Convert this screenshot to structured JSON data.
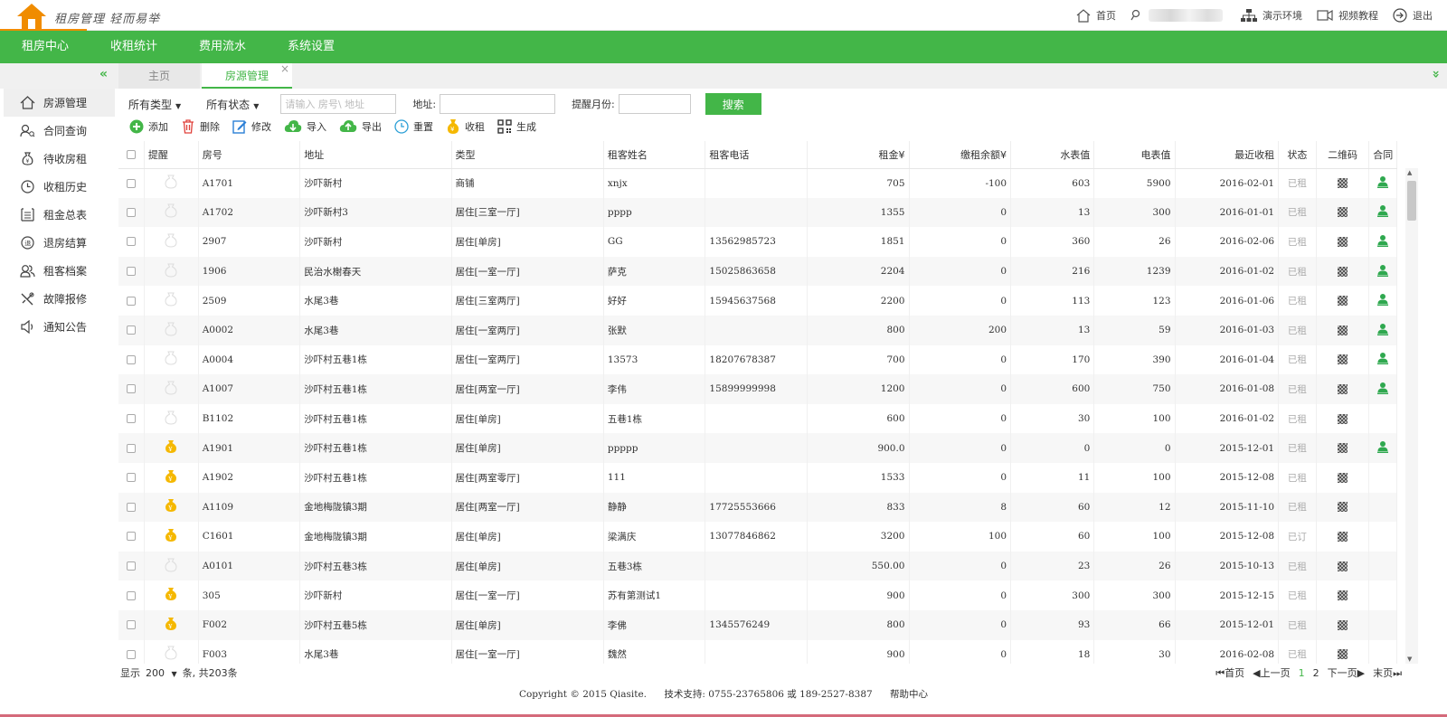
{
  "header": {
    "logo_text": "租房管理 轻而易举",
    "nav": {
      "home": "首页",
      "demo": "演示环境",
      "video": "视频教程",
      "logout": "退出"
    }
  },
  "menu": [
    "租房中心",
    "收租统计",
    "费用流水",
    "系统设置"
  ],
  "tabs": {
    "home": "主页",
    "active": "房源管理",
    "close": "×",
    "collapse": "«",
    "expand": "»"
  },
  "sidebar": [
    {
      "label": "房源管理",
      "icon": "house-icon"
    },
    {
      "label": "合同查询",
      "icon": "contract-search-icon"
    },
    {
      "label": "待收房租",
      "icon": "money-bag-icon"
    },
    {
      "label": "收租历史",
      "icon": "clock-icon"
    },
    {
      "label": "租金总表",
      "icon": "list-icon"
    },
    {
      "label": "退房结算",
      "icon": "checkout-icon"
    },
    {
      "label": "租客档案",
      "icon": "tenants-icon"
    },
    {
      "label": "故障报修",
      "icon": "repair-icon"
    },
    {
      "label": "通知公告",
      "icon": "speaker-icon"
    }
  ],
  "filters": {
    "type_select": "所有类型",
    "status_select": "所有状态",
    "keyword_placeholder": "请输入 房号\\ 地址",
    "address_label": "地址:",
    "month_label": "提醒月份:",
    "search_button": "搜索"
  },
  "toolbar": {
    "add": "添加",
    "delete": "删除",
    "edit": "修改",
    "import": "导入",
    "export": "导出",
    "reset": "重置",
    "collect": "收租",
    "generate": "生成"
  },
  "table": {
    "headers": {
      "remind": "提醒",
      "room": "房号",
      "address": "地址",
      "type": "类型",
      "tenant": "租客姓名",
      "phone": "租客电话",
      "rent": "租金¥",
      "balance": "缴租余额¥",
      "water": "水表值",
      "power": "电表值",
      "last": "最近收租",
      "status": "状态",
      "qr": "二维码",
      "contract": "合同"
    },
    "rows": [
      {
        "remind": false,
        "room": "A1701",
        "address": "沙吓新村",
        "type": "商铺",
        "tenant": "xnjx",
        "phone": "",
        "rent": "705",
        "balance": "-100",
        "water": "603",
        "power": "5900",
        "last": "2016-02-01",
        "status": "已租",
        "contract": true
      },
      {
        "remind": false,
        "room": "A1702",
        "address": "沙吓新村3",
        "type": "居住[三室一厅]",
        "tenant": "pppp",
        "phone": "",
        "rent": "1355",
        "balance": "0",
        "water": "13",
        "power": "300",
        "last": "2016-01-01",
        "status": "已租",
        "contract": true
      },
      {
        "remind": false,
        "room": "2907",
        "address": "沙吓新村",
        "type": "居住[单房]",
        "tenant": "GG",
        "phone": "13562985723",
        "rent": "1851",
        "balance": "0",
        "water": "360",
        "power": "26",
        "last": "2016-02-06",
        "status": "已租",
        "contract": true
      },
      {
        "remind": false,
        "room": "1906",
        "address": "民治水榭春天",
        "type": "居住[一室一厅]",
        "tenant": "萨克",
        "phone": "15025863658",
        "rent": "2204",
        "balance": "0",
        "water": "216",
        "power": "1239",
        "last": "2016-01-02",
        "status": "已租",
        "contract": true
      },
      {
        "remind": false,
        "room": "2509",
        "address": "水尾3巷",
        "type": "居住[三室两厅]",
        "tenant": "好好",
        "phone": "15945637568",
        "rent": "2200",
        "balance": "0",
        "water": "113",
        "power": "123",
        "last": "2016-01-06",
        "status": "已租",
        "contract": true
      },
      {
        "remind": false,
        "room": "A0002",
        "address": "水尾3巷",
        "type": "居住[一室两厅]",
        "tenant": "张默",
        "phone": "",
        "rent": "800",
        "balance": "200",
        "water": "13",
        "power": "59",
        "last": "2016-01-03",
        "status": "已租",
        "contract": true
      },
      {
        "remind": false,
        "room": "A0004",
        "address": "沙吓村五巷1栋",
        "type": "居住[一室两厅]",
        "tenant": "13573",
        "phone": "18207678387",
        "rent": "700",
        "balance": "0",
        "water": "170",
        "power": "390",
        "last": "2016-01-04",
        "status": "已租",
        "contract": true
      },
      {
        "remind": false,
        "room": "A1007",
        "address": "沙吓村五巷1栋",
        "type": "居住[两室一厅]",
        "tenant": "李伟",
        "phone": "15899999998",
        "rent": "1200",
        "balance": "0",
        "water": "600",
        "power": "750",
        "last": "2016-01-08",
        "status": "已租",
        "contract": true
      },
      {
        "remind": false,
        "room": "B1102",
        "address": "沙吓村五巷1栋",
        "type": "居住[单房]",
        "tenant": "五巷1栋",
        "phone": "",
        "rent": "600",
        "balance": "0",
        "water": "30",
        "power": "100",
        "last": "2016-01-02",
        "status": "已租",
        "contract": false
      },
      {
        "remind": true,
        "room": "A1901",
        "address": "沙吓村五巷1栋",
        "type": "居住[单房]",
        "tenant": "ppppp",
        "phone": "",
        "rent": "900.0",
        "balance": "0",
        "water": "0",
        "power": "0",
        "last": "2015-12-01",
        "status": "已租",
        "contract": true
      },
      {
        "remind": true,
        "room": "A1902",
        "address": "沙吓村五巷1栋",
        "type": "居住[两室零厅]",
        "tenant": "111",
        "phone": "",
        "rent": "1533",
        "balance": "0",
        "water": "11",
        "power": "100",
        "last": "2015-12-08",
        "status": "已租",
        "contract": false
      },
      {
        "remind": true,
        "room": "A1109",
        "address": "金地梅陇镇3期",
        "type": "居住[两室一厅]",
        "tenant": "静静",
        "phone": "17725553666",
        "rent": "833",
        "balance": "8",
        "water": "60",
        "power": "12",
        "last": "2015-11-10",
        "status": "已租",
        "contract": false
      },
      {
        "remind": true,
        "room": "C1601",
        "address": "金地梅陇镇3期",
        "type": "居住[单房]",
        "tenant": "梁满庆",
        "phone": "13077846862",
        "rent": "3200",
        "balance": "100",
        "water": "60",
        "power": "100",
        "last": "2015-12-08",
        "status": "已订",
        "contract": false
      },
      {
        "remind": false,
        "room": "A0101",
        "address": "沙吓村五巷3栋",
        "type": "居住[单房]",
        "tenant": "五巷3栋",
        "phone": "",
        "rent": "550.00",
        "balance": "0",
        "water": "23",
        "power": "26",
        "last": "2015-10-13",
        "status": "已租",
        "contract": false
      },
      {
        "remind": true,
        "room": "305",
        "address": "沙吓新村",
        "type": "居住[一室一厅]",
        "tenant": "苏有第测试1",
        "phone": "",
        "rent": "900",
        "balance": "0",
        "water": "300",
        "power": "300",
        "last": "2015-12-15",
        "status": "已租",
        "contract": false
      },
      {
        "remind": true,
        "room": "F002",
        "address": "沙吓村五巷5栋",
        "type": "居住[单房]",
        "tenant": "李佛",
        "phone": "1345576249",
        "rent": "800",
        "balance": "0",
        "water": "93",
        "power": "66",
        "last": "2015-12-01",
        "status": "已租",
        "contract": false
      },
      {
        "remind": false,
        "room": "F003",
        "address": "水尾3巷",
        "type": "居住[一室一厅]",
        "tenant": "魏然",
        "phone": "",
        "rent": "900",
        "balance": "0",
        "water": "18",
        "power": "30",
        "last": "2016-02-08",
        "status": "已租",
        "contract": false
      }
    ]
  },
  "pager": {
    "show_label": "显示",
    "page_size": "200",
    "summary": "条, 共203条",
    "first": "首页",
    "prev": "上一页",
    "page1": "1",
    "page2": "2",
    "next": "下一页",
    "last": "末页"
  },
  "footer": {
    "copyright": "Copyright © 2015 Qiasite.",
    "support": "技术支持: 0755-23765806 或 189-2527-8387",
    "help": "帮助中心"
  },
  "colors": {
    "brand_green": "#43b648",
    "remind_gold": "#f5b800",
    "contract_green": "#2fa84f"
  }
}
